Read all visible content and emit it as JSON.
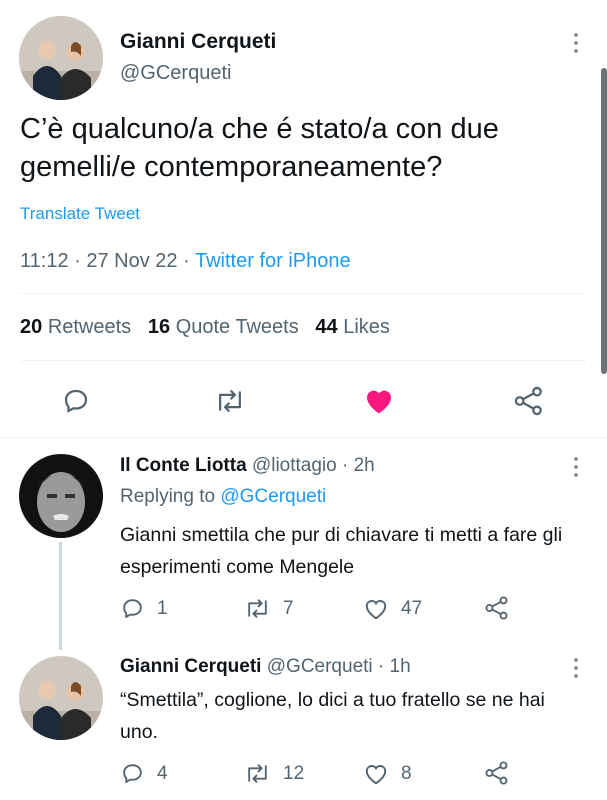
{
  "main_tweet": {
    "author_name": "Gianni Cerqueti",
    "handle": "@GCerqueti",
    "text": "C’è qualcuno/a che é stato/a con due gemelli/e contemporaneamente?",
    "translate_label": "Translate Tweet",
    "time": "11:12",
    "date": "27 Nov 22",
    "source": "Twitter for iPhone",
    "separator": "·",
    "stats": {
      "retweets_count": "20",
      "retweets_label": "Retweets",
      "quotes_count": "16",
      "quotes_label": "Quote Tweets",
      "likes_count": "44",
      "likes_label": "Likes"
    },
    "liked": true
  },
  "replies": [
    {
      "author_name": "Il Conte Liotta",
      "handle": "@liottagio",
      "age": "2h",
      "replying_prefix": "Replying to",
      "replying_to": "@GCerqueti",
      "text": "Gianni smettila che pur di chiavare ti metti a fare gli esperimenti come Mengele",
      "reply_count": "1",
      "retweet_count": "7",
      "like_count": "47"
    },
    {
      "author_name": "Gianni Cerqueti",
      "handle": "@GCerqueti",
      "age": "1h",
      "text": "“Smettila”, coglione, lo dici a tuo fratello se ne hai uno.",
      "reply_count": "4",
      "retweet_count": "12",
      "like_count": "8"
    }
  ],
  "icons": [
    "more-icon",
    "reply-icon",
    "retweet-icon",
    "like-icon",
    "share-icon"
  ],
  "colors": {
    "accent": "#1d9bf0",
    "like": "#f91880",
    "text": "#0f1419",
    "muted": "#536471"
  }
}
